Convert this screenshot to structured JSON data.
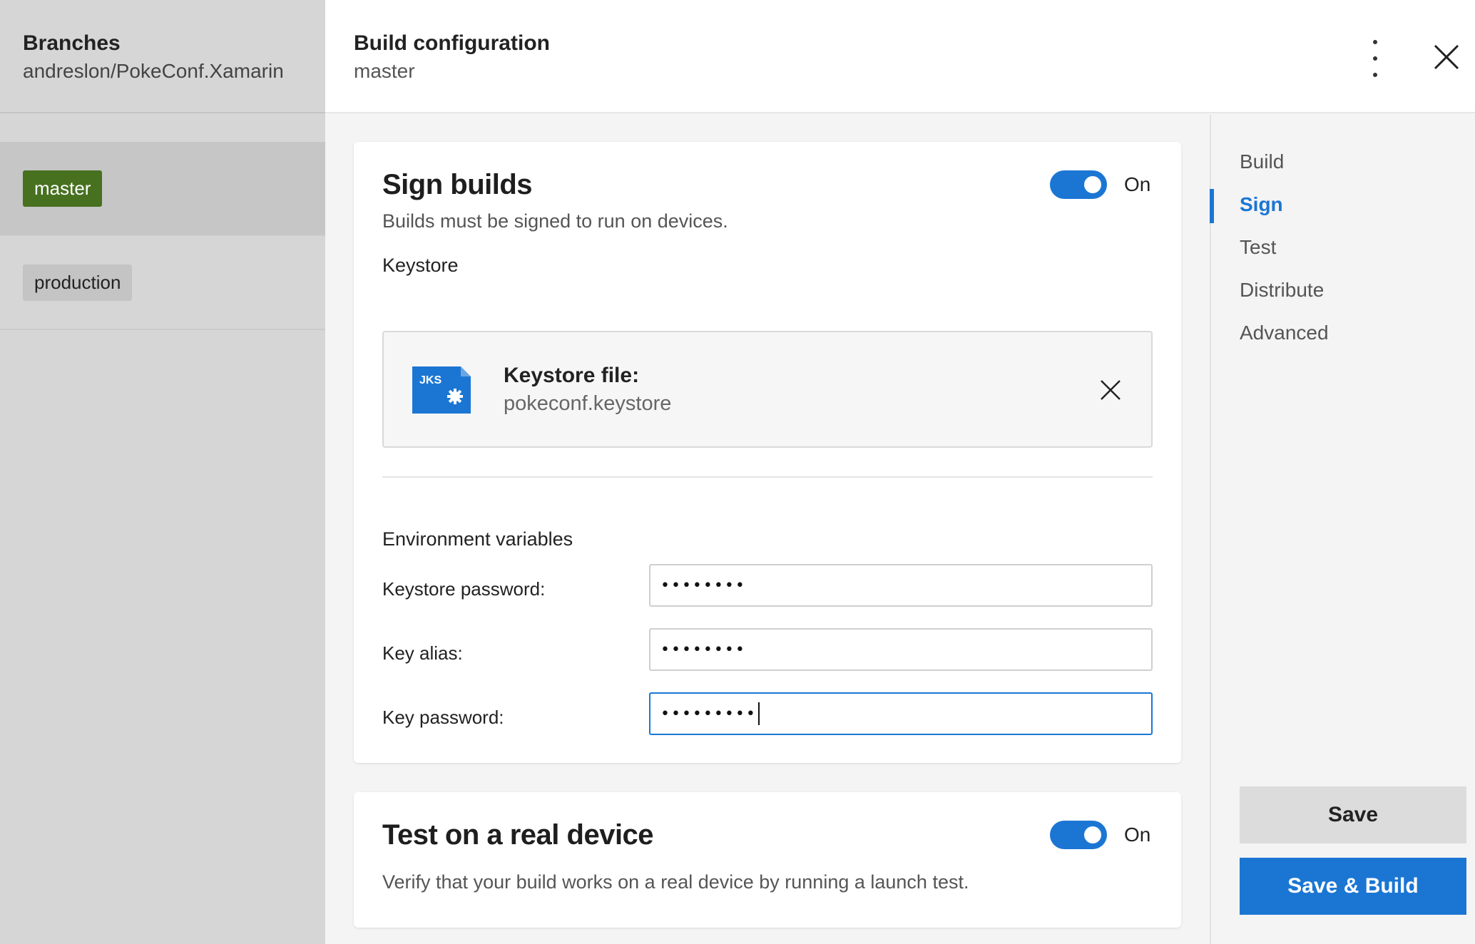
{
  "branches_panel": {
    "title": "Branches",
    "repo": "andreslon/PokeConf.Xamarin",
    "items": [
      {
        "label": "master",
        "selected": true
      },
      {
        "label": "production",
        "selected": false
      }
    ]
  },
  "header": {
    "title": "Build configuration",
    "branch": "master",
    "icons": {
      "more": "more-vertical-icon",
      "close": "close-icon"
    }
  },
  "sign_card": {
    "title": "Sign builds",
    "description": "Builds must be signed to run on devices.",
    "toggle_state": "On",
    "keystore_heading": "Keystore",
    "keystore": {
      "icon_text": "JKS",
      "label": "Keystore file:",
      "filename": "pokeconf.keystore"
    },
    "env_heading": "Environment variables",
    "fields": [
      {
        "label": "Keystore password:",
        "value": "••••••••"
      },
      {
        "label": "Key alias:",
        "value": "••••••••"
      },
      {
        "label": "Key password:",
        "value": "•••••••••"
      }
    ]
  },
  "test_card": {
    "title": "Test on a real device",
    "description": "Verify that your build works on a real device by running a launch test.",
    "toggle_state": "On"
  },
  "right_nav": {
    "items": [
      "Build",
      "Sign",
      "Test",
      "Distribute",
      "Advanced"
    ],
    "active": "Sign"
  },
  "actions": {
    "save": "Save",
    "save_build": "Save & Build"
  },
  "colors": {
    "accent": "#1b76d3",
    "branch_active": "#47701f",
    "panel": "#d6d6d6"
  }
}
